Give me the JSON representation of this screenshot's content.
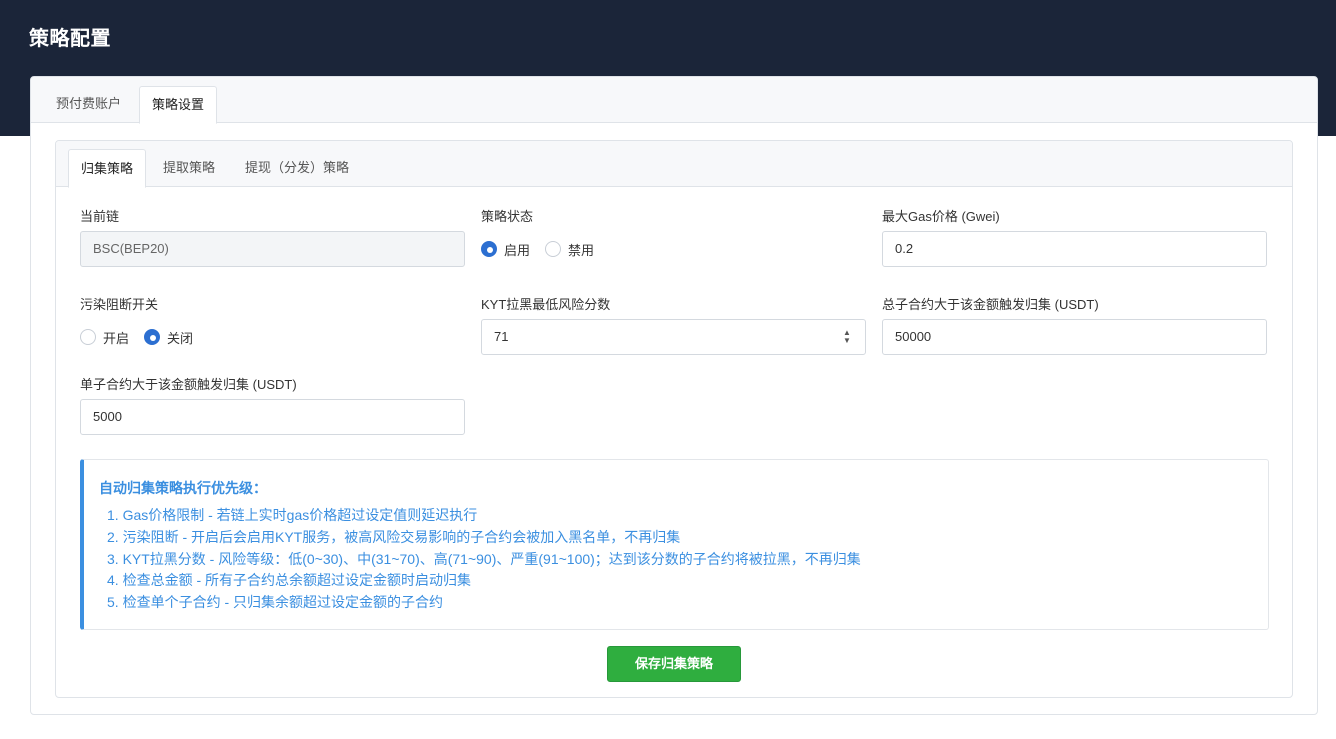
{
  "page": {
    "title": "策略配置"
  },
  "outer_tabs": [
    {
      "label": "预付费账户",
      "active": false
    },
    {
      "label": "策略设置",
      "active": true
    }
  ],
  "inner_tabs": [
    {
      "label": "归集策略",
      "active": true
    },
    {
      "label": "提取策略",
      "active": false
    },
    {
      "label": "提现（分发）策略",
      "active": false
    }
  ],
  "form": {
    "current_chain": {
      "label": "当前链",
      "value": "BSC(BEP20)"
    },
    "strategy_status": {
      "label": "策略状态",
      "options": [
        {
          "label": "启用",
          "checked": true
        },
        {
          "label": "禁用",
          "checked": false
        }
      ]
    },
    "max_gas_price": {
      "label": "最大Gas价格 (Gwei)",
      "value": "0.2"
    },
    "pollution_block": {
      "label": "污染阻断开关",
      "options": [
        {
          "label": "开启",
          "checked": false
        },
        {
          "label": "关闭",
          "checked": true
        }
      ]
    },
    "kyt_min_risk": {
      "label": "KYT拉黑最低风险分数",
      "value": "71"
    },
    "total_threshold": {
      "label": "总子合约大于该金额触发归集 (USDT)",
      "value": "50000"
    },
    "single_threshold": {
      "label": "单子合约大于该金额触发归集 (USDT)",
      "value": "5000"
    }
  },
  "info": {
    "title": "自动归集策略执行优先级：",
    "items": [
      "1. Gas价格限制 - 若链上实时gas价格超过设定值则延迟执行",
      "2. 污染阻断 - 开启后会启用KYT服务，被高风险交易影响的子合约会被加入黑名单，不再归集",
      "3. KYT拉黑分数 - 风险等级：低(0~30)、中(31~70)、高(71~90)、严重(91~100)；达到该分数的子合约将被拉黑，不再归集",
      "4. 检查总金额 - 所有子合约总余额超过设定金额时启动归集",
      "5. 检查单个子合约 - 只归集余额超过设定金额的子合约"
    ]
  },
  "actions": {
    "save_label": "保存归集策略"
  },
  "colors": {
    "header_bg": "#1b2539",
    "accent_blue": "#3b8fe0",
    "radio_blue": "#2c6fd1",
    "save_green": "#2fae3f"
  }
}
